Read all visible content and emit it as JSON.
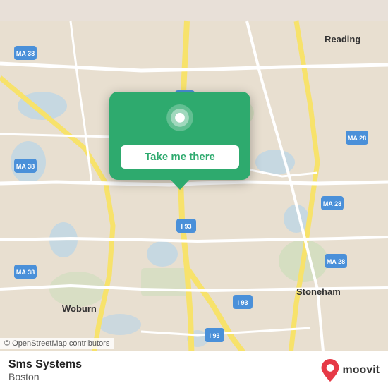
{
  "map": {
    "background_color": "#e8e0d8",
    "osm_attribution": "© OpenStreetMap contributors"
  },
  "popup": {
    "button_label": "Take me there",
    "pin_icon": "location-pin"
  },
  "bottom_bar": {
    "location_name": "Sms Systems",
    "location_city": "Boston",
    "moovit_label": "moovit"
  },
  "roads": {
    "color_highway": "#f7e26b",
    "color_major": "#ffffff",
    "color_highway_label": "#555",
    "route_labels": [
      "MA 38",
      "MA 28",
      "I 93",
      "Reading",
      "Woburn",
      "Stoneham"
    ]
  }
}
